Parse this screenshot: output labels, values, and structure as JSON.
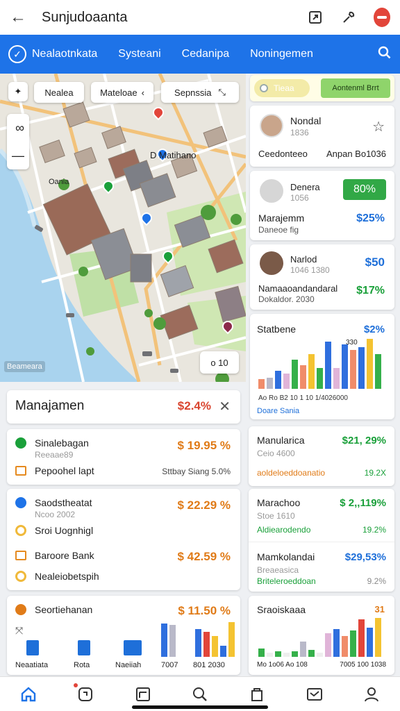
{
  "header": {
    "title": "Sunjudoaanta"
  },
  "nav": {
    "tabs": [
      "Nealaotnkata",
      "Systeani",
      "Cedanipa",
      "Noningemen"
    ]
  },
  "map": {
    "filters": [
      "Nealea",
      "Mateloae",
      "Sepnssia"
    ],
    "labels": {
      "place1": "D Matihano",
      "place2": "Oania",
      "corner": "Beameara",
      "zoom": "ᴏ 10"
    }
  },
  "side": {
    "toggle_left": "Tieaa",
    "toggle_right": "Aontenml Brrt",
    "c1": {
      "name": "Nondal",
      "sub": "1836",
      "left": "Ceedonteeo",
      "right": "Anpan Bo1036"
    },
    "c2": {
      "name": "Denera",
      "sub": "1056",
      "badge": "80%",
      "title": "Marajemm",
      "value": "$25%",
      "sub2": "Daneoe fig"
    },
    "c3": {
      "name": "Narlod",
      "sub": "1046 1380",
      "value": "$50",
      "title": "Namaaoandandaral",
      "title2": "Dokaldor. 2030",
      "value2": "$17%"
    },
    "chart": {
      "title": "Statbene",
      "value": "$2%",
      "top": "330",
      "ticks": "Ao Ro B2 10 1 10 1/4026000",
      "foot": "Doare Sania"
    },
    "m1": {
      "title": "Manularica",
      "value": "$21, 29%",
      "sub": "Ceio 4600",
      "foot": "aoldeloeddoanatio",
      "pct": "19.2X"
    },
    "m2": {
      "title": "Marachoo",
      "value": "$ 2,,119%",
      "sub": "Stoe 1610",
      "foot": "Aldiearodendo",
      "pct": "19.2%"
    },
    "m3": {
      "title": "Mamkolandai",
      "value": "$29,53%",
      "sub": "Breaeasica",
      "foot": "Briteleroeddoan",
      "pct": "9.2%"
    },
    "m4": {
      "title": "Sraoiskaaa",
      "value": "31",
      "ticks": "Mo 1o06 Ao 108",
      "ticks2": "7005 100 1038"
    }
  },
  "main": {
    "title": "Manajamen",
    "value": "$2.4%",
    "g1": {
      "name": "Sinalebagan",
      "sub": "Reeaae89",
      "value": "$ 19.95 %",
      "row2": "Pepoohel lapt",
      "row2r": "Sttbay Siang 5.0%"
    },
    "g2": {
      "name": "Saodstheatat",
      "sub": "Ncoo 2002",
      "value": "$ 22.29 %",
      "row2": "Sroi Uognhigl",
      "row3": "Baroore Bank",
      "row3v": "$ 42.59 %",
      "row4": "Nealeiobetspih"
    },
    "g3": {
      "name": "Seortiehanan",
      "value": "$ 11.50 %",
      "l1": "Neaatiata",
      "l2": "Rota",
      "l3": "Naeiiah",
      "l4": "7007",
      "l5": "801 2030"
    }
  }
}
